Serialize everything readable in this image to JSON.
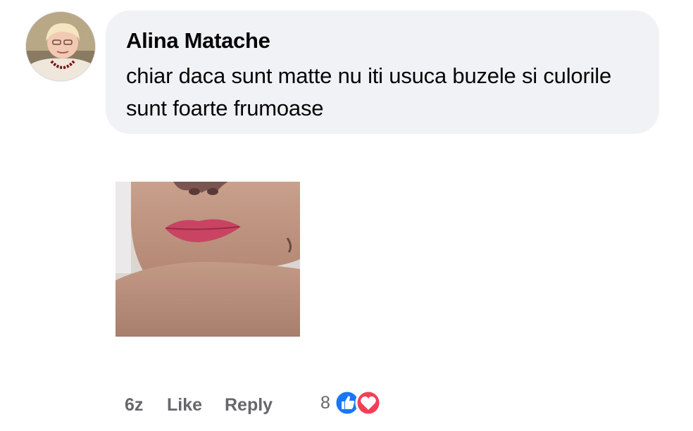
{
  "comment": {
    "author": "Alina Matache",
    "text": "chiar daca sunt matte nu iti usuca buzele si culorile sunt foarte frumoase",
    "avatar_icon": "profile-photo",
    "attachment_icon": "photo-lips-closeup"
  },
  "actions": {
    "timestamp": "6z",
    "like_label": "Like",
    "reply_label": "Reply"
  },
  "reactions": {
    "count": "8",
    "types": [
      "like-icon",
      "love-icon"
    ],
    "colors": {
      "like": "#1877f2",
      "love": "#f33e58"
    }
  },
  "colors": {
    "bubble_bg": "#f0f2f5",
    "meta_text": "#65676b",
    "main_text": "#050505"
  }
}
